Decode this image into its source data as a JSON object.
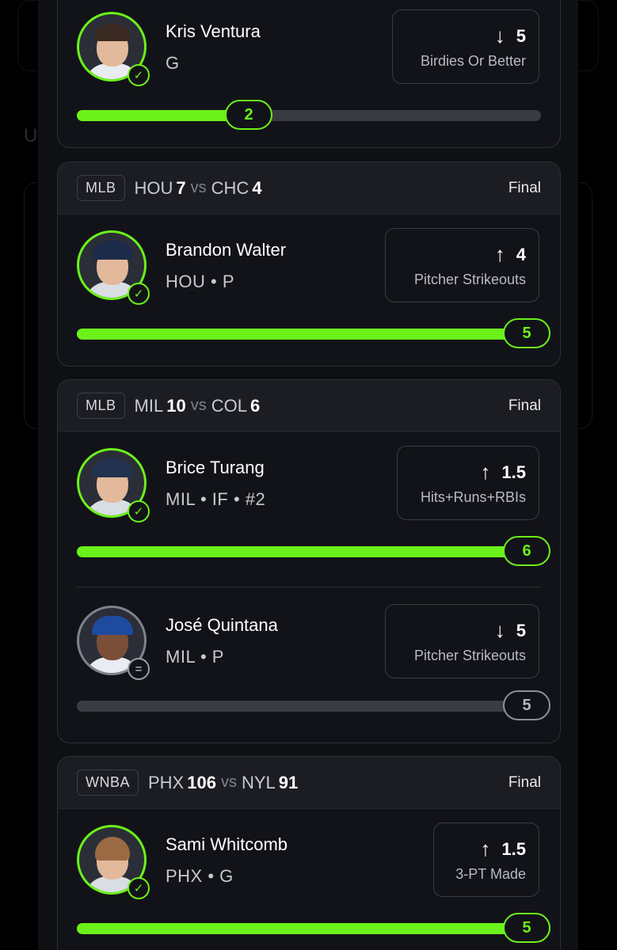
{
  "background": {
    "letter": "U"
  },
  "cards": [
    {
      "picks": [
        {
          "name": "Kris Ventura",
          "meta": "G",
          "direction": "down",
          "arrow": "↓",
          "line": "5",
          "stat": "Birdies Or Better",
          "result": "2",
          "progress": 0.37,
          "status": "hit"
        }
      ]
    },
    {
      "league": "MLB",
      "home": "HOU",
      "home_score": "7",
      "vs": "vs",
      "away": "CHC",
      "away_score": "4",
      "status": "Final",
      "picks": [
        {
          "name": "Brandon Walter",
          "meta": "HOU • P",
          "direction": "up",
          "arrow": "↑",
          "line": "4",
          "stat": "Pitcher Strikeouts",
          "result": "5",
          "progress": 1.0,
          "status": "hit"
        }
      ]
    },
    {
      "league": "MLB",
      "home": "MIL",
      "home_score": "10",
      "vs": "vs",
      "away": "COL",
      "away_score": "6",
      "status": "Final",
      "picks": [
        {
          "name": "Brice Turang",
          "meta": "MIL • IF • #2",
          "direction": "up",
          "arrow": "↑",
          "line": "1.5",
          "stat": "Hits+Runs+RBIs",
          "result": "6",
          "progress": 1.0,
          "status": "hit"
        },
        {
          "name": "José Quintana",
          "meta": "MIL • P",
          "direction": "down",
          "arrow": "↓",
          "line": "5",
          "stat": "Pitcher Strikeouts",
          "result": "5",
          "progress": 1.0,
          "status": "push"
        }
      ]
    },
    {
      "league": "WNBA",
      "home": "PHX",
      "home_score": "106",
      "vs": "vs",
      "away": "NYL",
      "away_score": "91",
      "status": "Final",
      "picks": [
        {
          "name": "Sami Whitcomb",
          "meta": "PHX • G",
          "direction": "up",
          "arrow": "↑",
          "line": "1.5",
          "stat": "3-PT Made",
          "result": "5",
          "progress": 1.0,
          "status": "hit"
        }
      ]
    }
  ],
  "icons": {
    "hit": "check-circle-icon",
    "push": "equals-circle-icon"
  },
  "colors": {
    "accent": "#6bf21a",
    "push": "#8e909b",
    "card": "#121318",
    "header": "#1c1d23"
  }
}
